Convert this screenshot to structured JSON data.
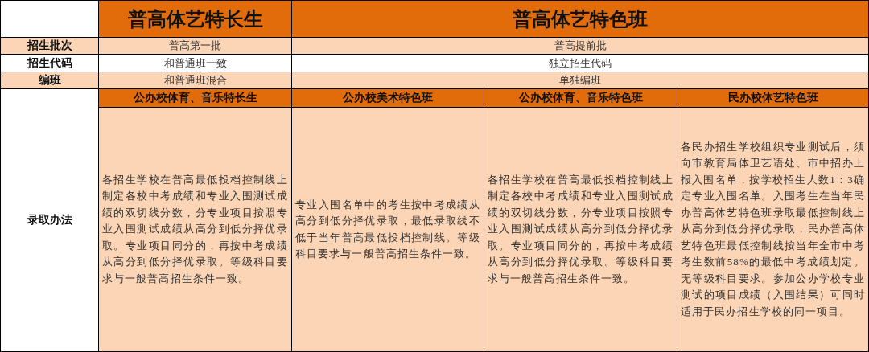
{
  "header": {
    "columns": [
      {
        "label": "普高体艺特长生"
      },
      {
        "label": "普高体艺特色班"
      }
    ]
  },
  "rows": [
    {
      "label": "招生批次",
      "values": [
        "普高第一批",
        "普高提前批"
      ],
      "shaded": true
    },
    {
      "label": "招生代码",
      "values": [
        "和普通班一致",
        "独立招生代码"
      ],
      "shaded": false
    },
    {
      "label": "编班",
      "values": [
        "和普通班混合",
        "单独编班"
      ],
      "shaded": true
    }
  ],
  "admission": {
    "label": "录取办法",
    "sub_columns": [
      {
        "title": "公办校体育、音乐特长生",
        "text": "各招生学校在普高最低投档控制线上制定各校中考成绩和专业入围测试成绩的双切线分数，分专业项目按照专业入围测试成绩从高分到低分择优录取。专业项目同分的，再按中考成绩从高分到低分择优录取。等级科目要求与一般普高招生条件一致。"
      },
      {
        "title": "公办校美术特色班",
        "text": "专业入围名单中的考生按中考成绩从高分到低分择优录取，最低录取线不低于当年普高最低投档控制线。等级科目要求与一般普高招生条件一致。"
      },
      {
        "title": "公办校体育、音乐特色班",
        "text": "各招生学校在普高最低投档控制线上制定各校中考成绩和专业入围测试成绩的双切线分数，分专业项目按照专业入围测试成绩从高分到低分择优录取。专业项目同分的，再按中考成绩从高分到低分择优录取。等级科目要求与一般普高招生条件一致。"
      },
      {
        "title": "民办校体艺特色班",
        "text": "各民办招生学校组织专业测试后，须向市教育局体卫艺语处、市中招办上报入围名单，按学校招生人数1：3确定专业入围名单。入围考生在当年民办普高体艺特色班录取最低控制线上从高分到低分择优录取，民办普高体艺特色班最低控制线按当年全市中考考生数前58%的最低中考成绩划定。无等级科目要求。参加公办学校专业测试的项目成绩（入围结果）可同时适用于民办招生学校的同一项目。"
      }
    ]
  }
}
